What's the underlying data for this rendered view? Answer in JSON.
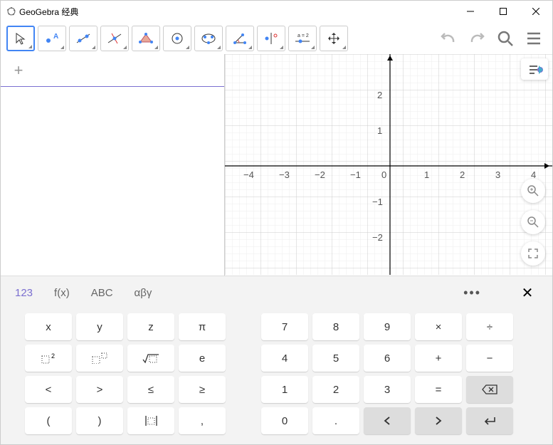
{
  "window": {
    "title": "GeoGebra 经典"
  },
  "toolbar": {
    "tools": [
      "move",
      "point",
      "line",
      "perpendicular",
      "polygon",
      "circle",
      "ellipse",
      "angle",
      "reflect",
      "slider",
      "move-view"
    ],
    "selected": 0
  },
  "keyboard": {
    "tabs": {
      "t0": "123",
      "t1": "f(x)",
      "t2": "ABC",
      "t3": "αβγ"
    },
    "r0": {
      "c0": "x",
      "c1": "y",
      "c2": "z",
      "c3": "π",
      "c4": "7",
      "c5": "8",
      "c6": "9",
      "c7": "×",
      "c8": "÷"
    },
    "r1": {
      "c0": "▫²",
      "c1": "▫^▫",
      "c2": "√▫",
      "c3": "e",
      "c4": "4",
      "c5": "5",
      "c6": "6",
      "c7": "+",
      "c8": "−"
    },
    "r2": {
      "c0": "<",
      "c1": ">",
      "c2": "≤",
      "c3": "≥",
      "c4": "1",
      "c5": "2",
      "c6": "3",
      "c7": "=",
      "c8": "⌫"
    },
    "r3": {
      "c0": "(",
      "c1": ")",
      "c2": "|▫|",
      "c3": ",",
      "c4": "0",
      "c5": ".",
      "c6": "‹",
      "c7": "›",
      "c8": "↵"
    }
  },
  "axes": {
    "x": {
      "n4": "−4",
      "n3": "−3",
      "n2": "−2",
      "n1": "−1",
      "p0": "0",
      "p1": "1",
      "p2": "2",
      "p3": "3",
      "p4": "4"
    },
    "y": {
      "n2": "−2",
      "n1": "−1",
      "p1": "1",
      "p2": "2"
    }
  }
}
